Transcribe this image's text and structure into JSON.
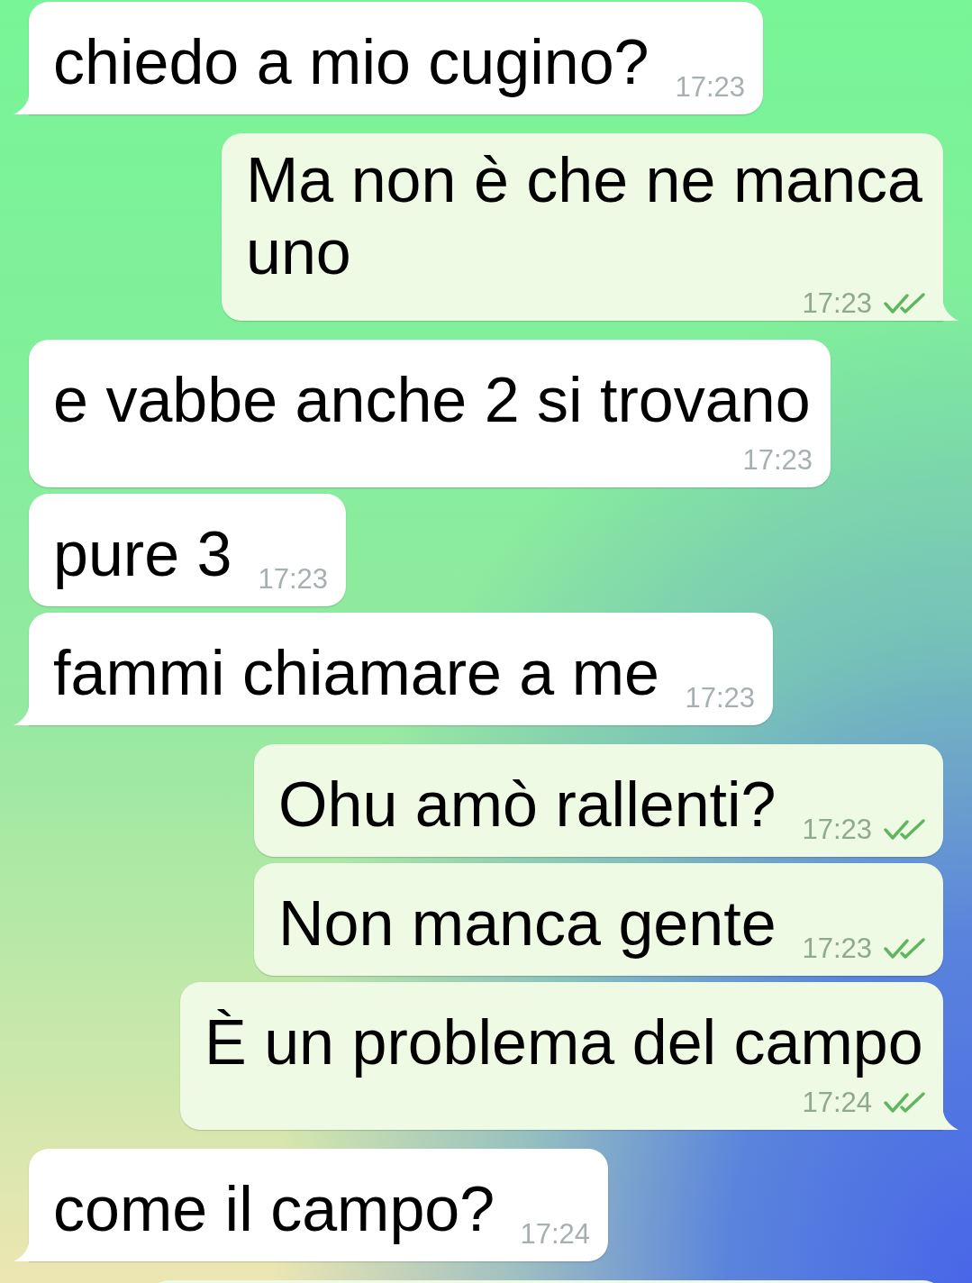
{
  "messages": [
    {
      "kind": "incoming",
      "text": "chiedo a mio cugino?",
      "time": "17:23"
    },
    {
      "kind": "outgoing",
      "text": "Ma non è che ne manca uno",
      "time": "17:23",
      "read": true
    },
    {
      "kind": "incoming",
      "text": "e vabbe anche 2 si trovano",
      "time": "17:23"
    },
    {
      "kind": "incoming",
      "text": "pure 3",
      "time": "17:23"
    },
    {
      "kind": "incoming",
      "text": "fammi chiamare a me",
      "time": "17:23"
    },
    {
      "kind": "outgoing",
      "text": "Ohu amò rallenti?",
      "time": "17:23",
      "read": true
    },
    {
      "kind": "outgoing",
      "text": "Non manca gente",
      "time": "17:23",
      "read": true
    },
    {
      "kind": "outgoing",
      "text": "È un problema del campo",
      "time": "17:24",
      "read": true
    },
    {
      "kind": "incoming",
      "text": "come il campo?",
      "time": "17:24"
    },
    {
      "kind": "outgoing"
    }
  ]
}
